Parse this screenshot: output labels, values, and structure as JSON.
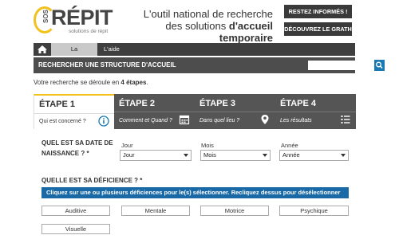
{
  "header": {
    "logo_prefix": "SOS",
    "logo_main": "RÉPIT",
    "logo_sub": "solutions de répit",
    "tagline_line1": "L'outil national de recherche",
    "tagline_line2_plain": "des solutions ",
    "tagline_line2_bold": "d'accueil temporaire",
    "btn_stay_informed": "RESTEZ INFORMÉS !",
    "btn_discover": "DÉCOUVREZ LE GRATH",
    "accent_color": "#f1c21b"
  },
  "nav": {
    "home_icon": "home-icon",
    "tabs": [
      {
        "label": "La recherche",
        "active": true
      },
      {
        "label": "L'aide",
        "active": false
      }
    ]
  },
  "search": {
    "title": "RECHERCHER UNE STRUCTURE D'ACCUEIL",
    "value": "",
    "placeholder": "",
    "icon": "search-icon",
    "button_color": "#1a7ab5"
  },
  "intro": {
    "text_before": "Votre recherche se déroule en ",
    "text_bold": "4 étapes",
    "text_after": "."
  },
  "steps": [
    {
      "label": "ÉTAPE 1",
      "desc": "Qui est concerné ?",
      "icon": "info-icon",
      "active": true
    },
    {
      "label": "ÉTAPE 2",
      "desc": "Comment et Quand ?",
      "icon": "calendar-icon",
      "active": false
    },
    {
      "label": "ÉTAPE 3",
      "desc": "Dans quel lieu ?",
      "icon": "map-pin-icon",
      "active": false
    },
    {
      "label": "ÉTAPE 4",
      "desc": "Les résultats",
      "icon": "list-icon",
      "active": false
    }
  ],
  "birthdate": {
    "question_line1": "QUEL EST SA DATE DE",
    "question_line2": "NAISSANCE ? *",
    "day_label": "Jour",
    "day_value": "Jour",
    "month_label": "Mois",
    "month_value": "Mois",
    "year_label": "Année",
    "year_value": "Année"
  },
  "deficiency": {
    "question": "QUELLE EST SA DÉFICIENCE ? *",
    "hint": "Cliquez sur une ou plusieurs déficiences pour le(s) sélectionner. Recliquez dessus pour désélectionner",
    "hint_color": "#1869a6",
    "options": [
      "Auditive",
      "Mentale",
      "Motrice",
      "Psychique",
      "Visuelle"
    ]
  }
}
